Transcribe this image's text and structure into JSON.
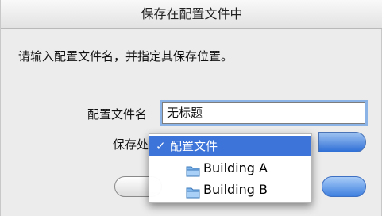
{
  "dialog": {
    "title": "保存在配置文件中",
    "prompt": "请输入配置文件名，并指定其保存位置。",
    "name_label": "配置文件名",
    "name_value": "无标题",
    "where_label": "保存处"
  },
  "popup_menu": {
    "items": [
      {
        "label": "配置文件",
        "checked": true,
        "icon": "checkmark"
      },
      {
        "label": "Building A",
        "icon": "folder-icon"
      },
      {
        "label": "Building B",
        "icon": "folder-icon"
      }
    ]
  },
  "colors": {
    "accent": "#3d74d9",
    "focus_ring": "#8bb3e6"
  }
}
